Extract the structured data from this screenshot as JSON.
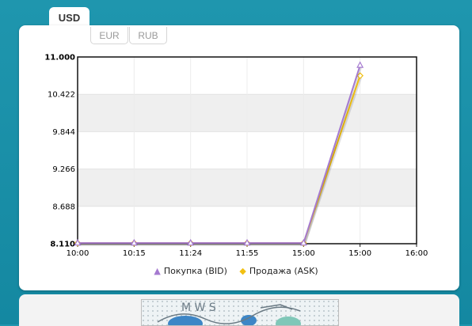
{
  "tabs": {
    "primary": "USD",
    "secondary": [
      "EUR",
      "RUB"
    ]
  },
  "chart_data": {
    "type": "line",
    "categories": [
      "10:00",
      "10:15",
      "11:24",
      "11:55",
      "15:00",
      "15:00",
      "16:00"
    ],
    "y_ticks": [
      "11.000",
      "10.422",
      "9.844",
      "9.266",
      "8.688",
      "8.110"
    ],
    "ylim": [
      8.11,
      11.0
    ],
    "series": [
      {
        "name": "Покупка (BID)",
        "color": "#a57ad0",
        "marker": "triangle",
        "values": [
          8.12,
          8.12,
          8.12,
          8.12,
          8.12,
          10.87,
          null
        ]
      },
      {
        "name": "Продажа (ASK)",
        "color": "#f2c012",
        "marker": "diamond",
        "values": [
          8.12,
          8.12,
          8.12,
          8.12,
          8.12,
          10.71,
          null
        ]
      }
    ],
    "grid": true
  },
  "captcha": {
    "glyphs": "M W S"
  }
}
